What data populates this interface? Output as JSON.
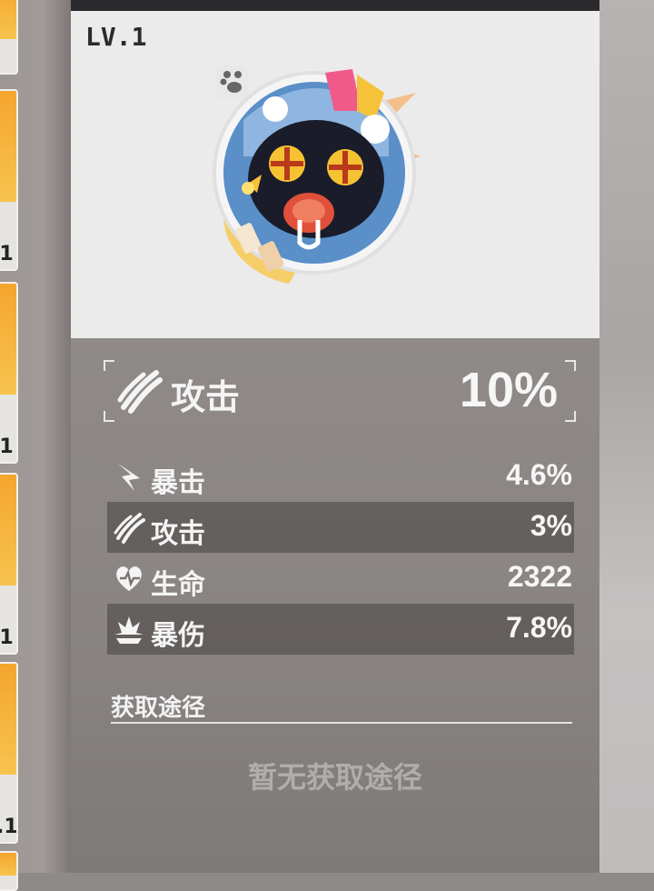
{
  "item_list": {
    "slots": [
      {
        "level": "",
        "icon": "gold-card"
      },
      {
        "level": "1",
        "icon": "gold-card"
      },
      {
        "level": "1",
        "icon": "gold-card"
      },
      {
        "level": "1",
        "icon": "gold-card"
      },
      {
        "level": ".1",
        "icon": "gold-card"
      }
    ]
  },
  "card": {
    "level": "LV.1",
    "portrait_icon": "blue-hooded-monster-icon",
    "paw_icon": "paw-icon",
    "main_stat": {
      "icon": "claw-icon",
      "label": "攻击",
      "value": "10%"
    },
    "sub_stats": [
      {
        "icon": "crit-icon",
        "label": "暴击",
        "value": "4.6%"
      },
      {
        "icon": "claw-icon",
        "label": "攻击",
        "value": "3%"
      },
      {
        "icon": "heart-pulse-icon",
        "label": "生命",
        "value": "2322"
      },
      {
        "icon": "crit-damage-icon",
        "label": "暴伤",
        "value": "7.8%"
      }
    ],
    "source_title": "获取途径",
    "source_empty": "暂无获取途径"
  },
  "colors": {
    "accent_gold": "#f4a52e",
    "text_light": "#f4f4f4",
    "panel_bg": "#8a8583",
    "card_top_bg": "#ebebeb"
  }
}
